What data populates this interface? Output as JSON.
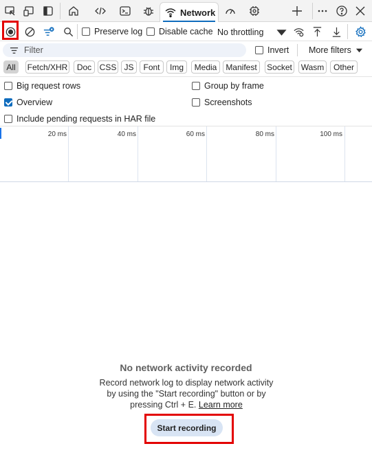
{
  "tabs": {
    "active_label": "Network"
  },
  "toolbar": {
    "preserve_log_label": "Preserve log",
    "preserve_log_checked": false,
    "disable_cache_label": "Disable cache",
    "disable_cache_checked": false,
    "throttling_value": "No throttling"
  },
  "filter": {
    "placeholder": "Filter",
    "invert_label": "Invert",
    "invert_checked": false,
    "more_filters_label": "More filters"
  },
  "type_filters": [
    "All",
    "Fetch/XHR",
    "Doc",
    "CSS",
    "JS",
    "Font",
    "Img",
    "Media",
    "Manifest",
    "Socket",
    "Wasm",
    "Other"
  ],
  "settings": {
    "big_request_rows": "Big request rows",
    "group_by_frame": "Group by frame",
    "overview": "Overview",
    "screenshots": "Screenshots",
    "include_pending": "Include pending requests in HAR file"
  },
  "timeline": {
    "ticks": [
      "20 ms",
      "40 ms",
      "60 ms",
      "80 ms",
      "100 ms"
    ]
  },
  "empty_state": {
    "title": "No network activity recorded",
    "description": "Record network log to display network activity by using the \"Start recording\" button or by pressing Ctrl + E.",
    "learn_more": "Learn more",
    "start_button": "Start recording"
  },
  "colors": {
    "accent": "#0f6cbd",
    "highlight_box": "#e30000",
    "start_button_bg": "#d8e4f4"
  }
}
